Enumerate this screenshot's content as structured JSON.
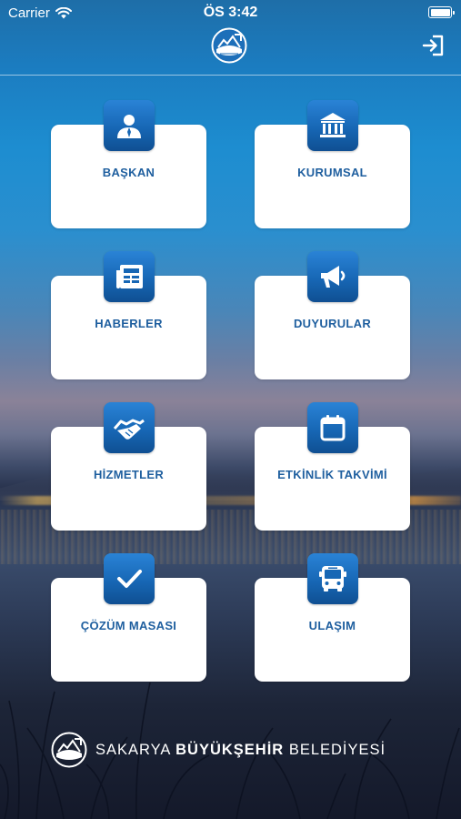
{
  "status_bar": {
    "carrier": "Carrier",
    "time": "ÖS 3:42",
    "icons": [
      "wifi-icon",
      "battery-icon"
    ]
  },
  "header": {
    "logo": "sakarya-logo-icon",
    "action_icon": "logout-icon"
  },
  "menu": {
    "items": [
      {
        "label": "BAŞKAN",
        "icon": "person-icon"
      },
      {
        "label": "KURUMSAL",
        "icon": "institution-icon"
      },
      {
        "label": "HABERLER",
        "icon": "newspaper-icon"
      },
      {
        "label": "DUYURULAR",
        "icon": "megaphone-icon"
      },
      {
        "label": "HİZMETLER",
        "icon": "handshake-icon"
      },
      {
        "label": "ETKİNLİK TAKVİMİ",
        "icon": "calendar-icon"
      },
      {
        "label": "ÇÖZÜM MASASI",
        "icon": "checkmark-icon"
      },
      {
        "label": "ULAŞIM",
        "icon": "bus-icon"
      }
    ]
  },
  "footer": {
    "brand_part1": "SAKARYA",
    "brand_part2": "BÜYÜKŞEHİR",
    "brand_part3": "BELEDİYESİ"
  },
  "colors": {
    "tile_label": "#1f5f9f",
    "icon_gradient_top": "#2a83d6",
    "icon_gradient_bottom": "#0f4f92",
    "card": "#ffffff"
  }
}
